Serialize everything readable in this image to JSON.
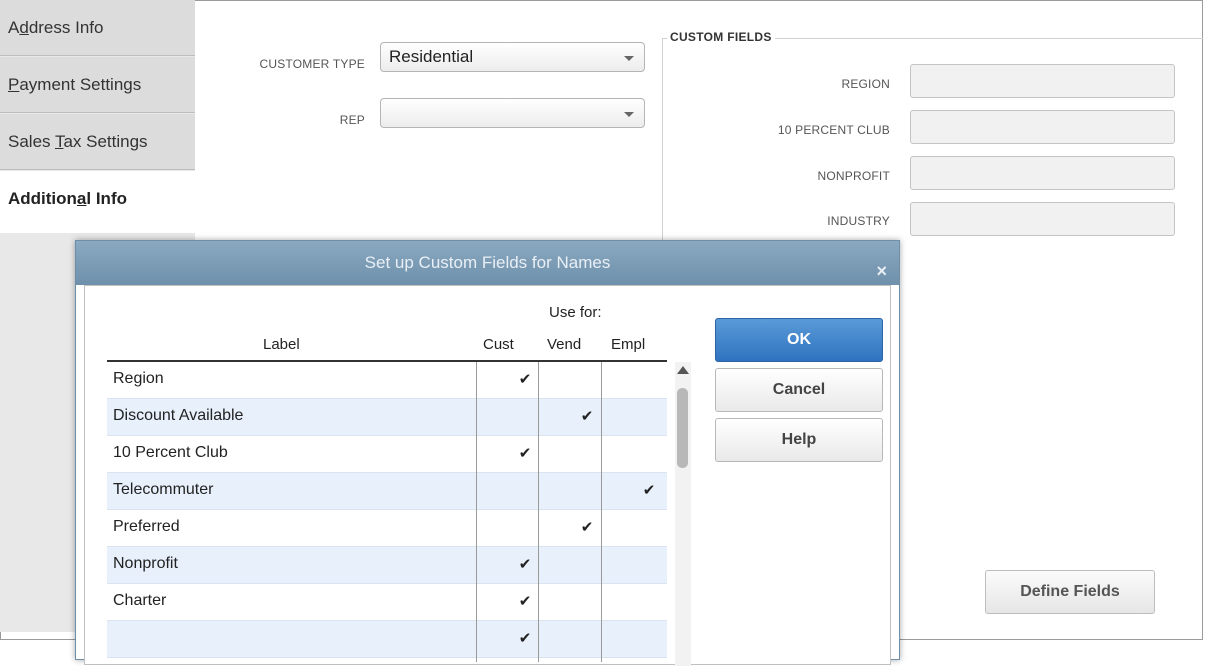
{
  "tabs": [
    {
      "label": "Address Info",
      "mnemonic_index": 1
    },
    {
      "label": "Payment Settings",
      "mnemonic_index": 0
    },
    {
      "label": "Sales Tax Settings",
      "mnemonic_index": 6
    },
    {
      "label": "Additional Info",
      "mnemonic_index": 8
    }
  ],
  "active_tab": "Additional Info",
  "form": {
    "customer_type_label": "CUSTOMER TYPE",
    "customer_type_value": "Residential",
    "rep_label": "REP",
    "rep_value": ""
  },
  "custom_fields": {
    "title": "CUSTOM FIELDS",
    "fields": [
      {
        "label": "REGION",
        "value": ""
      },
      {
        "label": "10 PERCENT CLUB",
        "value": ""
      },
      {
        "label": "NONPROFIT",
        "value": ""
      },
      {
        "label": "INDUSTRY",
        "value": ""
      }
    ],
    "define_button": "Define Fields"
  },
  "dialog": {
    "title": "Set up Custom Fields for Names",
    "close_glyph": "×",
    "use_for_label": "Use for:",
    "columns": {
      "label": "Label",
      "cust": "Cust",
      "vend": "Vend",
      "empl": "Empl"
    },
    "rows": [
      {
        "label": "Region",
        "cust": "✔",
        "vend": "",
        "empl": ""
      },
      {
        "label": "Discount Available",
        "cust": "",
        "vend": "✔",
        "empl": ""
      },
      {
        "label": "10 Percent Club",
        "cust": "✔",
        "vend": "",
        "empl": ""
      },
      {
        "label": "Telecommuter",
        "cust": "",
        "vend": "",
        "empl": "✔"
      },
      {
        "label": "Preferred",
        "cust": "",
        "vend": "✔",
        "empl": ""
      },
      {
        "label": "Nonprofit",
        "cust": "✔",
        "vend": "",
        "empl": ""
      },
      {
        "label": "Charter",
        "cust": "✔",
        "vend": "",
        "empl": ""
      },
      {
        "label": "",
        "cust": "✔",
        "vend": "",
        "empl": ""
      }
    ],
    "buttons": {
      "ok": "OK",
      "cancel": "Cancel",
      "help": "Help"
    }
  }
}
